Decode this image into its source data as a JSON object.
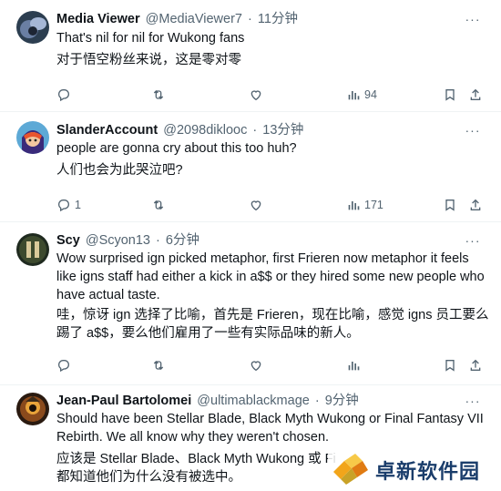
{
  "tweets": [
    {
      "name": "Media Viewer",
      "handle": "@MediaViewer7",
      "sep": "·",
      "time": "11分钟",
      "line1": "That's nil for nil for Wukong fans",
      "line2": "对于悟空粉丝来说，这是零对零",
      "replies": "",
      "retweets": "",
      "likes": "",
      "views": "94"
    },
    {
      "name": "SlanderAccount",
      "handle": "@2098diklooc",
      "sep": "·",
      "time": "13分钟",
      "line1": "people are gonna cry about this too huh?",
      "line2": "人们也会为此哭泣吧?",
      "replies": "1",
      "retweets": "",
      "likes": "",
      "views": "171"
    },
    {
      "name": "Scy",
      "handle": "@Scyon13",
      "sep": "·",
      "time": "6分钟",
      "line1": "Wow surprised ign picked metaphor, first Frieren now metaphor it feels like igns staff had either a kick in a$$ or they hired some new people who have actual taste.",
      "line2": "哇，惊讶 ign 选择了比喻，首先是 Frieren，现在比喻，感觉 igns 员工要么踢了 a$$，要么他们雇用了一些有实际品味的新人。",
      "replies": "",
      "retweets": "",
      "likes": "",
      "views": ""
    },
    {
      "name": "Jean-Paul Bartolomei",
      "handle": "@ultimablackmage",
      "sep": "·",
      "time": "9分钟",
      "line1": "Should have been Stellar Blade, Black Myth Wukong or Final Fantasy VII Rebirth. We all know why they weren't chosen.",
      "line2": "应该是 Stellar Blade、Black Myth Wukong 或 Fi",
      "line3": "都知道他们为什么没有被选中。"
    }
  ],
  "watermark": {
    "text": "卓新软件园"
  },
  "colors": {
    "text": "#0f1419",
    "muted": "#536471",
    "divider": "#eff3f4"
  }
}
